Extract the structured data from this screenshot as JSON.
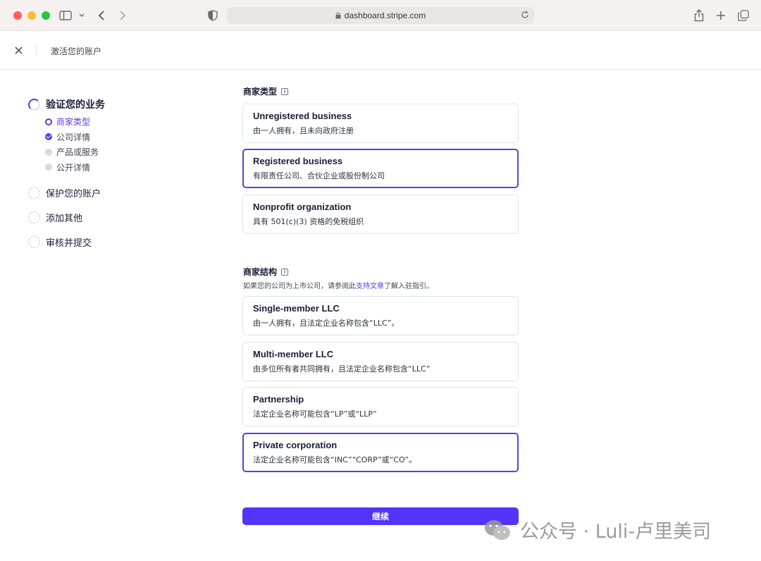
{
  "browser": {
    "url": "dashboard.stripe.com"
  },
  "header": {
    "title": "激活您的账户"
  },
  "sidebar": {
    "steps": [
      {
        "label": "验证您的业务",
        "substeps": [
          {
            "label": "商家类型"
          },
          {
            "label": "公司详情"
          },
          {
            "label": "产品或服务"
          },
          {
            "label": "公开详情"
          }
        ]
      },
      {
        "label": "保护您的账户"
      },
      {
        "label": "添加其他"
      },
      {
        "label": "审核并提交"
      }
    ]
  },
  "business_type": {
    "title": "商家类型",
    "options": [
      {
        "title": "Unregistered business",
        "desc": "由一人拥有，且未向政府注册"
      },
      {
        "title": "Registered business",
        "desc": "有限责任公司、合伙企业或股份制公司"
      },
      {
        "title": "Nonprofit organization",
        "desc": "具有 501(c)(3) 资格的免税组织"
      }
    ]
  },
  "business_structure": {
    "title": "商家结构",
    "hint_before": "如果您的公司为上市公司，请参阅此",
    "hint_link": "支持文章",
    "hint_after": "了解入驻指引。",
    "options": [
      {
        "title": "Single-member LLC",
        "desc": "由一人拥有，且法定企业名称包含“LLC”。"
      },
      {
        "title": "Multi-member LLC",
        "desc": "由多位所有者共同拥有，且法定企业名称包含“LLC”"
      },
      {
        "title": "Partnership",
        "desc": "法定企业名称可能包含“LP”或“LLP”"
      },
      {
        "title": "Private corporation",
        "desc": "法定企业名称可能包含“INC”“CORP”或“CO”。"
      }
    ]
  },
  "continue_label": "继续",
  "watermark": "公众号 · Luli-卢里美司",
  "colors": {
    "accent": "#5533ff",
    "selected_border": "#5d3be0"
  }
}
